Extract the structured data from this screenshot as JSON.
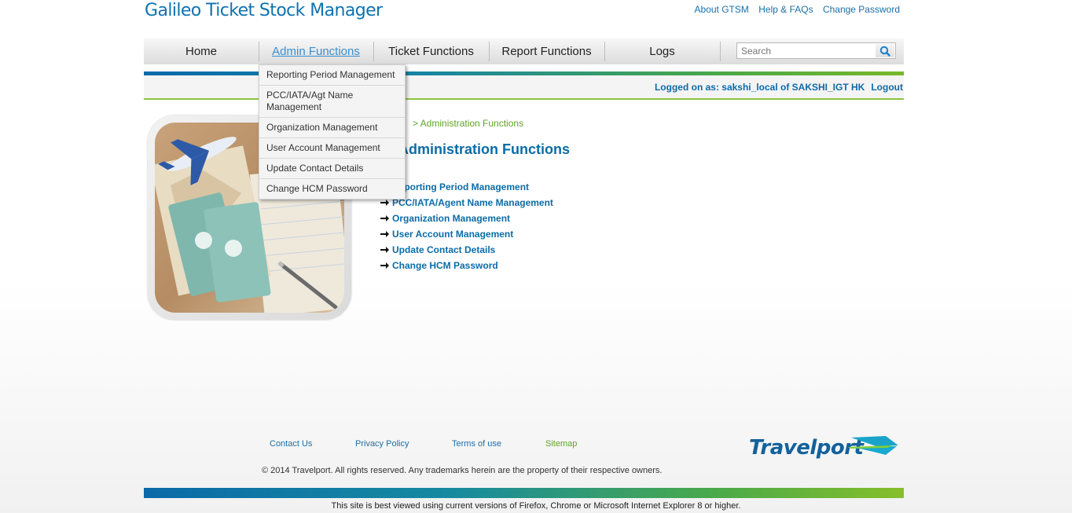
{
  "app": {
    "title": "Galileo Ticket Stock Manager"
  },
  "top_links": [
    "About GTSM",
    "Help & FAQs",
    "Change Password"
  ],
  "nav": {
    "items": [
      "Home",
      "Admin Functions",
      "Ticket Functions",
      "Report Functions",
      "Logs"
    ],
    "active": "Admin Functions",
    "search_placeholder": "Search"
  },
  "status": {
    "logged_on": "Logged on as: sakshi_local of SAKSHI_IGT HK",
    "logout": "Logout"
  },
  "dropdown": {
    "items": [
      "Reporting Period Management",
      "PCC/IATA/Agt Name Management",
      "Organization Management",
      "User Account Management",
      "Update Contact Details",
      "Change HCM Password"
    ]
  },
  "breadcrumb": {
    "current": "> Administration Functions"
  },
  "main": {
    "title": "Administration Functions",
    "links": [
      "Reporting Period Management",
      "PCC/IATA/Agent Name Management",
      "Organization Management",
      "User Account Management",
      "Update Contact Details",
      "Change HCM Password"
    ]
  },
  "footer": {
    "contact": "Contact Us",
    "privacy": "Privacy Policy",
    "terms": "Terms of use",
    "sitemap": "Sitemap",
    "copyright": "© 2014 Travelport. All rights reserved. Any trademarks herein are the property of their respective owners.",
    "logo": "Travelport",
    "best_viewed": "This site is best viewed using current versions of Firefox, Chrome or Microsoft Internet Explorer 8 or higher."
  },
  "colors": {
    "brand_blue": "#0a6ca7",
    "accent_green": "#8cc63e"
  }
}
